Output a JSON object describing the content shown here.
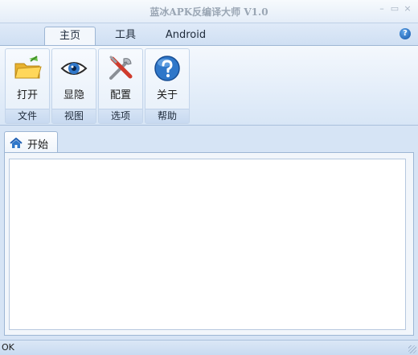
{
  "window": {
    "title": "蓝冰APK反编译大师 V1.0",
    "minimize_glyph": "–",
    "maximize_glyph": "▭",
    "close_glyph": "×"
  },
  "menu": {
    "tabs": [
      {
        "label": "主页",
        "active": true
      },
      {
        "label": "工具",
        "active": false
      },
      {
        "label": "Android",
        "active": false
      }
    ],
    "help_glyph": "?"
  },
  "ribbon": {
    "groups": [
      {
        "button_label": "打开",
        "group_label": "文件",
        "icon": "folder-icon"
      },
      {
        "button_label": "显隐",
        "group_label": "视图",
        "icon": "eye-icon"
      },
      {
        "button_label": "配置",
        "group_label": "选项",
        "icon": "tools-icon"
      },
      {
        "button_label": "关于",
        "group_label": "帮助",
        "icon": "help-icon"
      }
    ]
  },
  "documents": {
    "tabs": [
      {
        "label": "开始",
        "icon": "home-icon"
      }
    ]
  },
  "status": {
    "text": "OK"
  },
  "colors": {
    "accent": "#2f77c9",
    "ribbon_bg": "#e3edf9",
    "frame": "#d6e4f5"
  }
}
